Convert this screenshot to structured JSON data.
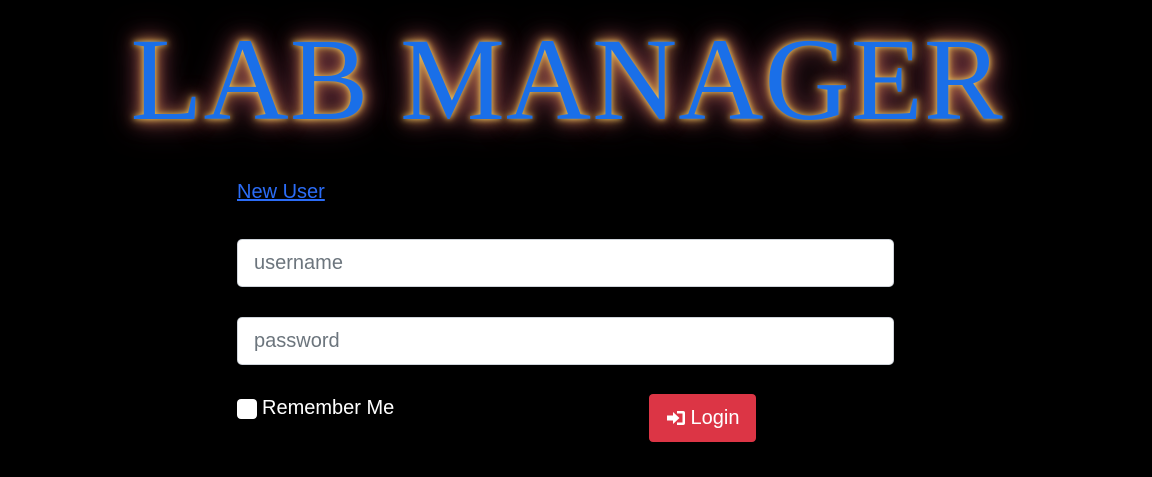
{
  "header": {
    "title": "LAB MANAGER"
  },
  "links": {
    "new_user": "New User"
  },
  "form": {
    "username_placeholder": "username",
    "username_value": "",
    "password_placeholder": "password",
    "password_value": "",
    "remember_label": "Remember Me",
    "remember_checked": false,
    "login_label": "Login",
    "login_icon": "sign-in-icon"
  },
  "colors": {
    "background": "#000000",
    "title": "#1a6fe8",
    "title_glow": "#e6c25a",
    "link": "#2b6cf6",
    "login_button": "#dc3545"
  }
}
